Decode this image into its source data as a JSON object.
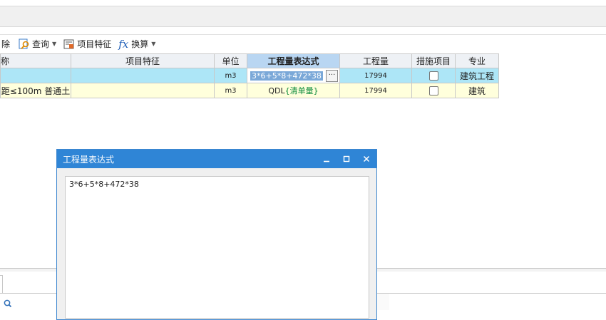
{
  "toolbar": {
    "delete_label": "除",
    "query_label": "查询",
    "feature_label": "项目特征",
    "convert_label": "换算"
  },
  "grid": {
    "headers": [
      "称",
      "项目特征",
      "单位",
      "工程量表达式",
      "工程量",
      "措施项目",
      "专业"
    ],
    "rows": [
      {
        "name": "",
        "feature": "",
        "unit": "m3",
        "expr": "3*6+5*8+472*38",
        "qty": "17994",
        "specialty": "建筑工程"
      },
      {
        "name": "距≤100m 普通土",
        "feature": "",
        "unit": "m3",
        "expr_prefix": "QDL",
        "expr_suffix": "{清单量}",
        "qty": "17994",
        "specialty": "建筑"
      }
    ],
    "edit_button": "···"
  },
  "dialog": {
    "title": "工程量表达式",
    "expression": "3*6+5*8+472*38",
    "minimize": "▁",
    "maximize": "□",
    "close": "✕"
  },
  "colors": {
    "selected_row": "#ade6f7",
    "second_row": "#ffffdc",
    "dialog_title_bg": "#2f85d6"
  }
}
